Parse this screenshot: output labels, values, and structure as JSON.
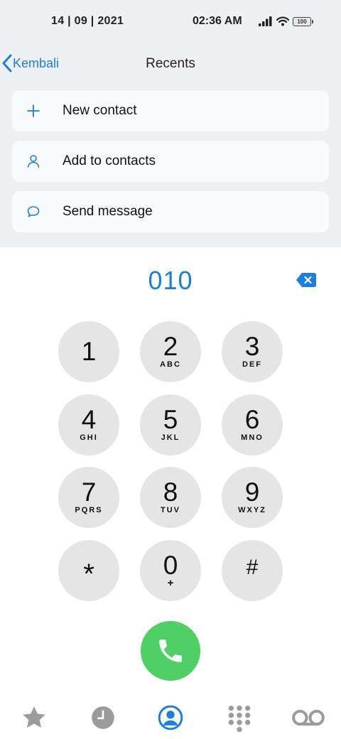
{
  "status_bar": {
    "date": "14 | 09 | 2021",
    "time": "02:36 AM",
    "battery_level": "100",
    "icons": [
      "signal-icon",
      "wifi-icon",
      "battery-icon"
    ]
  },
  "nav": {
    "back_label": "Kembali",
    "title": "Recents"
  },
  "actions": [
    {
      "label": "New contact",
      "icon": "plus-icon"
    },
    {
      "label": "Add to contacts",
      "icon": "person-icon"
    },
    {
      "label": "Send message",
      "icon": "message-bubble-icon"
    }
  ],
  "dialer": {
    "number": "010",
    "keys": [
      {
        "digit": "1",
        "letters": ""
      },
      {
        "digit": "2",
        "letters": "ABC"
      },
      {
        "digit": "3",
        "letters": "DEF"
      },
      {
        "digit": "4",
        "letters": "GHI"
      },
      {
        "digit": "5",
        "letters": "JKL"
      },
      {
        "digit": "6",
        "letters": "MNO"
      },
      {
        "digit": "7",
        "letters": "PQRS"
      },
      {
        "digit": "8",
        "letters": "TUV"
      },
      {
        "digit": "9",
        "letters": "WXYZ"
      },
      {
        "digit": "*",
        "letters": ""
      },
      {
        "digit": "0",
        "letters": "+"
      },
      {
        "digit": "#",
        "letters": ""
      }
    ]
  },
  "tabs": [
    {
      "name": "favorites",
      "icon": "star-icon",
      "active": false
    },
    {
      "name": "recents",
      "icon": "clock-icon",
      "active": false
    },
    {
      "name": "contacts",
      "icon": "person-circle-icon",
      "active": true
    },
    {
      "name": "keypad",
      "icon": "keypad-grid-icon",
      "active": false
    },
    {
      "name": "voicemail",
      "icon": "voicemail-icon",
      "active": false
    }
  ],
  "colors": {
    "accent": "#1a7fe0",
    "call_green": "#4ed065",
    "key_gray": "#e5e5e6",
    "top_background": "#eff0f4",
    "inactive_tab": "#9b9b9b"
  }
}
